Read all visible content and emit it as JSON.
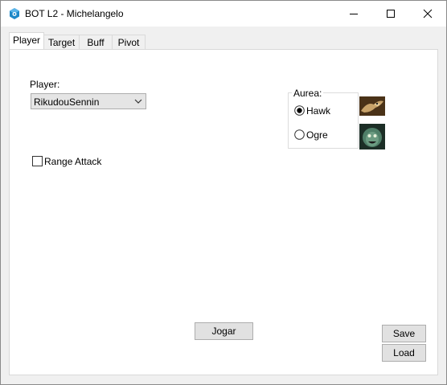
{
  "window": {
    "title": "BOT L2 - Michelangelo",
    "app_icon": "gear-cube-icon",
    "controls": [
      "minimize-icon",
      "maximize-icon",
      "close-icon"
    ]
  },
  "tabs": [
    {
      "label": "Player",
      "active": true
    },
    {
      "label": "Target",
      "active": false
    },
    {
      "label": "Buff",
      "active": false
    },
    {
      "label": "Pivot",
      "active": false
    }
  ],
  "player": {
    "label": "Player:",
    "selected": "RikudouSennin"
  },
  "range_attack": {
    "label": "Range Attack",
    "checked": false
  },
  "aurea": {
    "title": "Aurea:",
    "options": [
      {
        "label": "Hawk",
        "selected": true,
        "icon": "hawk-skill-icon"
      },
      {
        "label": "Ogre",
        "selected": false,
        "icon": "ogre-skill-icon"
      }
    ]
  },
  "buttons": {
    "jogar": "Jogar",
    "save": "Save",
    "load": "Load"
  },
  "colors": {
    "window_bg": "#f0f0f0",
    "panel_bg": "#ffffff",
    "button_bg": "#e1e1e1",
    "app_icon": "#1e88c8"
  }
}
